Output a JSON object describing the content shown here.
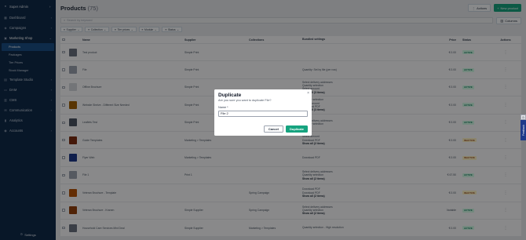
{
  "sidebar": {
    "user": "Super Admin",
    "items": [
      {
        "label": "Dashboard"
      },
      {
        "label": "Campaigns"
      },
      {
        "label": "Marketing Shop"
      }
    ],
    "sub_items": [
      {
        "label": "Products"
      },
      {
        "label": "Packages"
      },
      {
        "label": "Tier Prices"
      },
      {
        "label": "Stock Manager"
      }
    ],
    "items_after": [
      {
        "label": "Template Studio"
      },
      {
        "label": "DAM"
      },
      {
        "label": "CMS"
      },
      {
        "label": "Communication"
      },
      {
        "label": "Analytics"
      },
      {
        "label": "Accounts"
      }
    ],
    "settings_label": "Settings"
  },
  "header": {
    "title": "Products",
    "count": "(75)",
    "actions_label": "Actions",
    "new_product_label": "New product"
  },
  "search": {
    "placeholder": "Search by keyword"
  },
  "columns_label": "Columns",
  "filters": [
    {
      "label": "Supplier"
    },
    {
      "label": "Collection"
    },
    {
      "label": "Tier prices"
    },
    {
      "label": "Module"
    },
    {
      "label": "Status"
    }
  ],
  "table": {
    "headers": {
      "name": "Name",
      "supplier": "Supplier",
      "collections": "Collections",
      "bundled": "Bundled settings",
      "price": "Price",
      "status": "Status",
      "actions": "Actions"
    },
    "rows": [
      {
        "name": "Test product",
        "supplier": "Simple Print",
        "collections": "",
        "bundled": [],
        "more": "",
        "price": "€ 0.00",
        "status": "ACTIVE",
        "thumb": "#6b7280"
      },
      {
        "name": "File",
        "supplier": "Simple Print",
        "collections": "",
        "bundled": [
          "Quantity: Set by file (per row)"
        ],
        "more": "",
        "price": "€ 0.00",
        "status": "ACTIVE",
        "thumb": "#9ca3af"
      },
      {
        "name": "Offline Brochure",
        "supplier": "Simple Print",
        "collections": "",
        "bundled": [
          "Select delivery addresses",
          "Quantity selection",
          "Select amount"
        ],
        "more": "Show all (3 items)",
        "price": "€ 0.00",
        "status": "ACTIVE",
        "thumb": "#d1d5db"
      },
      {
        "name": "Website Shelve - Different Size Needed",
        "supplier": "Simple Print",
        "collections": "",
        "bundled": [
          "Quantity selection",
          "Select amount",
          "Download PDF"
        ],
        "more": "Show all (3 items)",
        "price": "€ 0.00",
        "status": "ACTIVE",
        "thumb": "#a16207"
      },
      {
        "name": "Leaflets Test",
        "supplier": "Simple Print",
        "collections": "",
        "bundled": [
          "Select delivery addresses",
          "Quantity selection"
        ],
        "more": "",
        "price": "€ 0.00",
        "status": "ACTIVE",
        "thumb": "#4b5563"
      },
      {
        "name": "Guide Templates",
        "supplier": "Marketing > Templates",
        "collections": "",
        "bundled": [
          "Select amount",
          "Download PDF"
        ],
        "more": "Show all (2 items)",
        "price": "€ 0.00",
        "status": "INACTIVE",
        "thumb": "#7c2d12"
      },
      {
        "name": "Flyer Web",
        "supplier": "Marketing > Templates",
        "collections": "",
        "bundled": [
          "Download PDF"
        ],
        "more": "",
        "price": "€ 0.00",
        "status": "INACTIVE",
        "thumb": "#1e3a8a"
      },
      {
        "name": "File 1",
        "supplier": "Print 1",
        "collections": "",
        "bundled": [
          "Select delivery addresses",
          "Quantity selection"
        ],
        "more": "Show all (2 items)",
        "price": "€ 67.50",
        "status": "ACTIVE",
        "thumb": "#9ca3af"
      },
      {
        "name": "Veteran Brochure - Template",
        "supplier": "",
        "collections": "Spring Campaign",
        "bundled": [
          "Download PDF",
          "Download PDF"
        ],
        "more": "Show all (2 items)",
        "price": "€ 0.00",
        "status": "INACTIVE",
        "thumb": "#b45309"
      },
      {
        "name": "Veteran Brochure - Kranen",
        "supplier": "Simple Supplier",
        "collections": "Spring Campaign",
        "bundled": [
          "Select delivery addresses",
          "Quantity selection"
        ],
        "more": "Show all (2 items)",
        "price": "Variable",
        "status": "ACTIVE",
        "thumb": "#92400e"
      },
      {
        "name": "Household Care Services Mini Deal",
        "supplier": "Simple Supplier",
        "collections": "Marketing > Templates",
        "bundled": [
          "Quantity selection - High resolution"
        ],
        "more": "",
        "price": "€ 0.00",
        "status": "ACTIVE",
        "thumb": "#6b7280"
      }
    ]
  },
  "dialog": {
    "title": "Duplicate",
    "message": "Are you sure you want to duplicate File?",
    "name_label": "Name *",
    "name_value": "File 2",
    "cancel_label": "Cancel",
    "duplicate_label": "Duplicate"
  },
  "feedback_label": "Feedback",
  "colors": {
    "accent": "#16a37f",
    "sidebar": "#0f2a4a"
  }
}
